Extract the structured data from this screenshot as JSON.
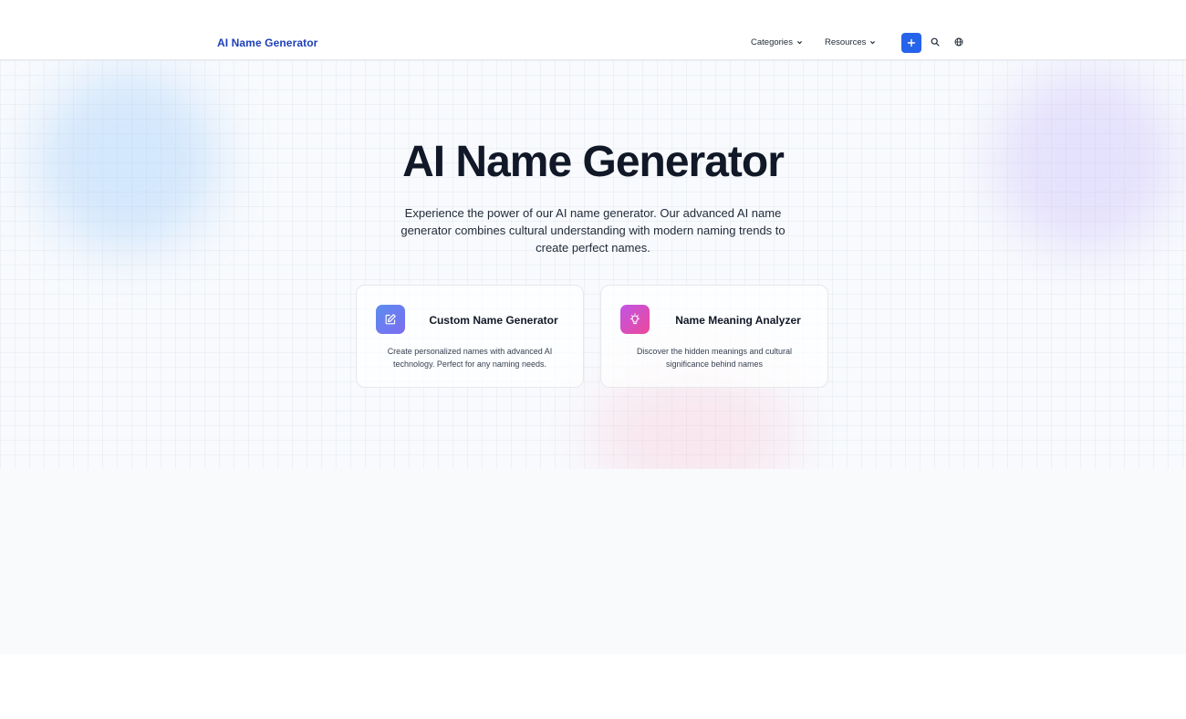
{
  "header": {
    "brand": "AI Name Generator",
    "nav": [
      {
        "label": "Categories",
        "icon": "chevron-down-icon"
      },
      {
        "label": "Resources",
        "icon": "chevron-down-icon"
      }
    ],
    "actions": [
      {
        "icon": "plus-icon"
      },
      {
        "icon": "search-icon"
      },
      {
        "icon": "globe-icon"
      }
    ]
  },
  "hero": {
    "title": "AI Name Generator",
    "subtitle": "Experience the power of our AI name generator. Our advanced AI name generator combines cultural understanding with modern naming trends to create perfect names."
  },
  "cards": [
    {
      "title": "Custom Name Generator",
      "description": "Create personalized names with advanced AI technology. Perfect for any naming needs.",
      "icon": "edit-icon"
    },
    {
      "title": "Name Meaning Analyzer",
      "description": "Discover the hidden meanings and cultural significance behind names",
      "icon": "lightbulb-icon"
    }
  ],
  "colors": {
    "brand": "#1d3fb8",
    "accent": "#2563eb"
  }
}
